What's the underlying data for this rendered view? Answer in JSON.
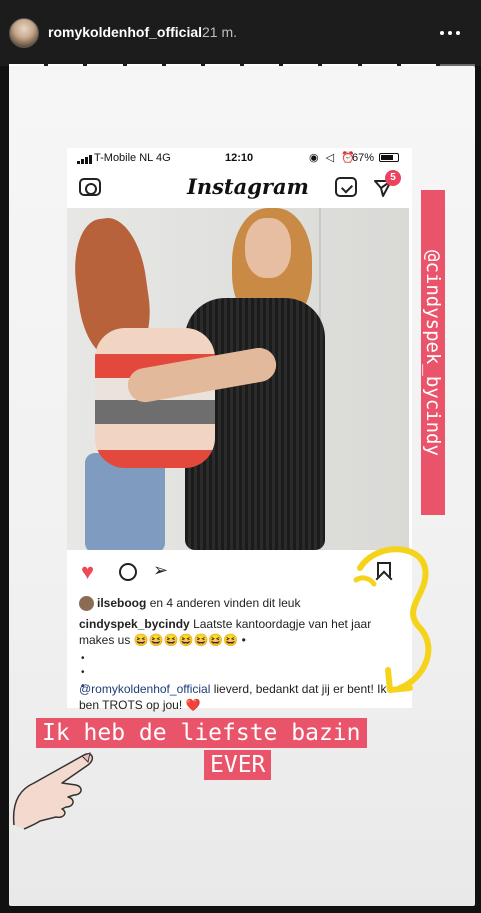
{
  "header": {
    "username": "romykoldenhof_official",
    "time_ago": "21 m.",
    "more_icon": "more-horizontal-icon"
  },
  "progress": {
    "segments_total": 12,
    "segments_seen": 11
  },
  "phone": {
    "status_bar": {
      "carrier": "T-Mobile NL  4G",
      "clock": "12:10",
      "icons": "◉ ◁ ⏰",
      "battery": "67%"
    },
    "nav": {
      "logo": "Instagram",
      "dm_badge": "5"
    },
    "post": {
      "likes": {
        "user": "ilseboog",
        "rest": "en 4 anderen vinden dit leuk"
      },
      "caption": {
        "author": "cindyspek_bycindy",
        "text": "Laatste kantoordagje van het jaar makes us 😆😆😆😆😆😆😆 •"
      },
      "dots": [
        "•",
        "•",
        "•"
      ],
      "reply": {
        "mention": "@romykoldenhof_official",
        "text": "lieverd, bedankt dat jij er bent! Ik ben TROTS op jou!",
        "heart": "❤️"
      }
    }
  },
  "stickers": {
    "vertical_tag": "@cindyspek_bycindy",
    "banner_line1": "Ik heb de liefste bazin",
    "banner_line2": "EVER"
  },
  "colors": {
    "sticker_pink": "#e9546b",
    "arrow_yellow": "#f6d31b",
    "like_red": "#ed4956"
  }
}
